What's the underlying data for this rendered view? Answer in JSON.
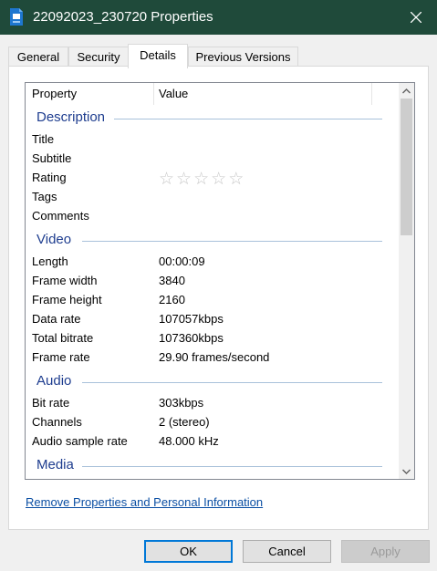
{
  "window": {
    "title": "22092023_230720 Properties"
  },
  "tabs": [
    {
      "label": "General"
    },
    {
      "label": "Security"
    },
    {
      "label": "Details"
    },
    {
      "label": "Previous Versions"
    }
  ],
  "table": {
    "headers": {
      "property": "Property",
      "value": "Value"
    },
    "groups": {
      "description": {
        "label": "Description",
        "rows": [
          {
            "key": "Title",
            "value": ""
          },
          {
            "key": "Subtitle",
            "value": ""
          },
          {
            "key": "Rating",
            "value": "",
            "stars": 0,
            "max_stars": 5
          },
          {
            "key": "Tags",
            "value": ""
          },
          {
            "key": "Comments",
            "value": ""
          }
        ]
      },
      "video": {
        "label": "Video",
        "rows": [
          {
            "key": "Length",
            "value": "00:00:09"
          },
          {
            "key": "Frame width",
            "value": "3840"
          },
          {
            "key": "Frame height",
            "value": "2160"
          },
          {
            "key": "Data rate",
            "value": "107057kbps"
          },
          {
            "key": "Total bitrate",
            "value": "107360kbps"
          },
          {
            "key": "Frame rate",
            "value": "29.90 frames/second"
          }
        ]
      },
      "audio": {
        "label": "Audio",
        "rows": [
          {
            "key": "Bit rate",
            "value": "303kbps"
          },
          {
            "key": "Channels",
            "value": "2 (stereo)"
          },
          {
            "key": "Audio sample rate",
            "value": "48.000 kHz"
          }
        ]
      },
      "media": {
        "label": "Media"
      }
    }
  },
  "footer": {
    "remove_link": "Remove Properties and Personal Information",
    "ok": "OK",
    "cancel": "Cancel",
    "apply": "Apply"
  },
  "icons": {
    "app": "video-file-icon",
    "close": "close-icon",
    "scroll_up": "chevron-up-icon",
    "scroll_down": "chevron-down-icon",
    "star": "star-icon"
  },
  "colors": {
    "titlebar": "#1f4a3a",
    "group_heading": "#1e3d8f",
    "link": "#0a4ea3",
    "ok_border": "#0078d7"
  }
}
